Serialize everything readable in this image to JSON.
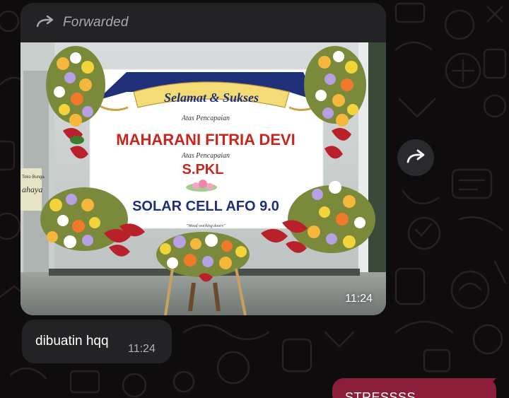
{
  "colors": {
    "background": "#0e0c0d",
    "incoming_bubble": "#232326",
    "outgoing_bubble": "#8c1e3a",
    "time_text": "#b2b2b6",
    "forwarded_text": "#a9a9ad"
  },
  "forwarded_message": {
    "header_icon": "forward-arrow-icon",
    "header_label": "Forwarded",
    "time": "11:24",
    "photo": {
      "banner_heading": "Selamat & Sukses",
      "line_1": "Atas Pencapaian",
      "name": "MAHARANI FITRIA DEVI",
      "line_2": "Atas Pencapaian",
      "title": "S.PKL",
      "organization": "SOLAR CELL AFO 9.0",
      "tagline": "\"Wood working doors\"",
      "shop_sign_line_1": "Toko Bunga",
      "shop_sign_line_2": "ahaya"
    }
  },
  "share_button": {
    "icon": "share-forward-icon"
  },
  "text_message": {
    "text": "dibuatin hqq",
    "time": "11:24"
  },
  "outgoing_message": {
    "text": "STRESSSS"
  }
}
